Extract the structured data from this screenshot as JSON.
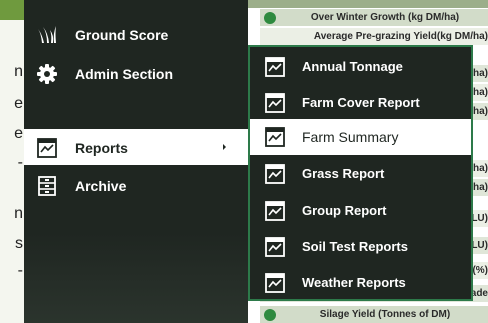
{
  "sidebar": {
    "items": [
      {
        "label": "Ground Score",
        "icon": "grass-logo-icon"
      },
      {
        "label": "Admin Section",
        "icon": "gear-icon"
      },
      {
        "label": "Reports",
        "icon": "report-icon",
        "has_submenu": true,
        "active": true
      },
      {
        "label": "Archive",
        "icon": "archive-icon"
      }
    ]
  },
  "reports_submenu": {
    "items": [
      {
        "label": "Annual Tonnage",
        "icon": "report-icon"
      },
      {
        "label": "Farm Cover Report",
        "icon": "report-icon"
      },
      {
        "label": "Farm Summary",
        "icon": "report-icon",
        "active": true
      },
      {
        "label": "Grass Report",
        "icon": "report-icon"
      },
      {
        "label": "Group Report",
        "icon": "report-icon"
      },
      {
        "label": "Soil Test Reports",
        "icon": "report-icon"
      },
      {
        "label": "Weather Reports",
        "icon": "report-icon"
      }
    ]
  },
  "background_table": {
    "header": "Over Winter Growth (kg DM/ha)",
    "row_fragments": [
      "Average Pre-grazing Yield(kg DM/ha)",
      "ha)",
      "ha)",
      "ha)",
      "ha)",
      "ha)",
      "LU)",
      "LU)",
      "(%)",
      "ade"
    ],
    "footer": "Silage Yield (Tonnes of DM)"
  },
  "background_left": {
    "letters": [
      "n",
      "e",
      "e",
      "-",
      "n",
      "s",
      "-"
    ]
  },
  "colors": {
    "sidebar_bg": "#1f2621",
    "active_bg": "#ffffff",
    "flyout_border": "#2d7a4a",
    "table_icon": "#2e8a3f"
  }
}
